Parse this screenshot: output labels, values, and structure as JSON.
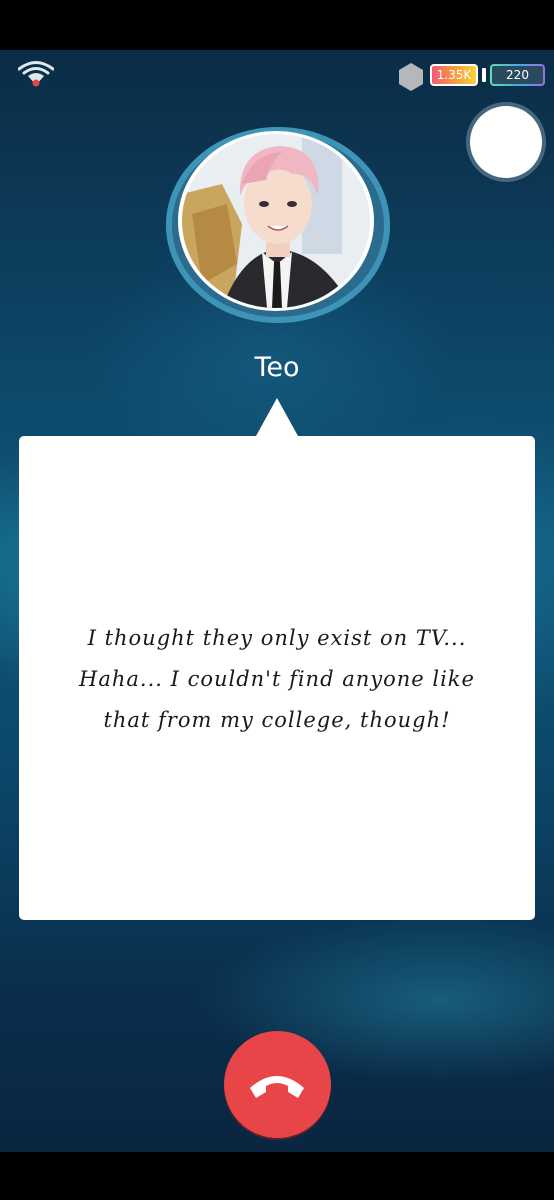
{
  "status_bar": {
    "hourglass_count": "1.35K",
    "battery_count": "220"
  },
  "call": {
    "caller_name": "Teo",
    "message_lines": [
      "I thought they only exist on TV...",
      "Haha... I couldn't find anyone like",
      "that from my college, though!"
    ]
  },
  "icons": {
    "signal": "wifi-signal-icon",
    "hexagon": "hexagon-icon",
    "record": "record-button-icon",
    "hangup": "phone-hangup-icon"
  },
  "colors": {
    "hangup": "#e84548",
    "avatar_ring": "#3e94b6",
    "bubble": "#ffffff"
  }
}
